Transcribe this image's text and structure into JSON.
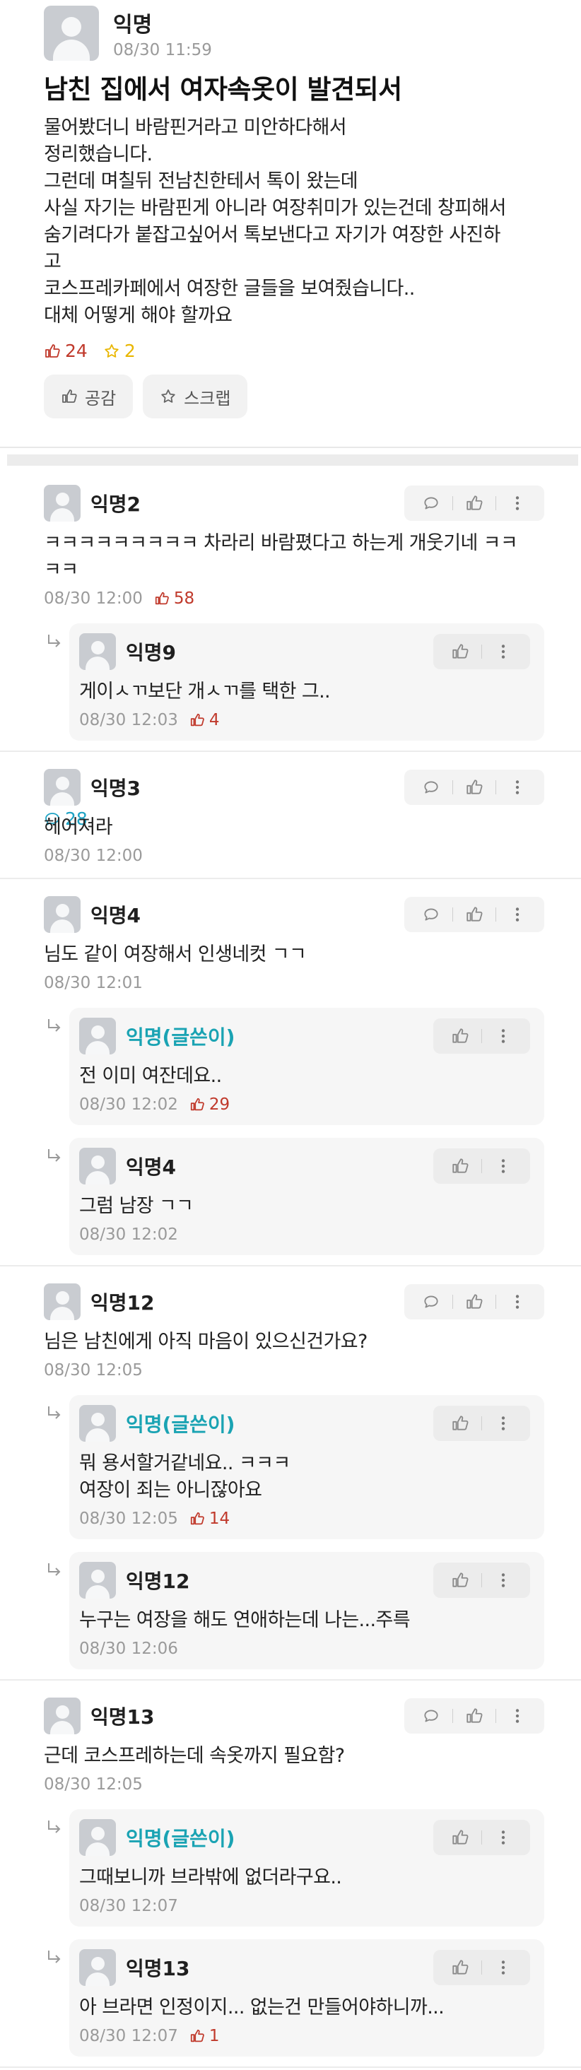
{
  "post": {
    "author": "익명",
    "date": "08/30 11:59",
    "title": "남친 집에서 여자속옷이 발견되서",
    "body": "물어봤더니 바람핀거라고 미안하다해서\n정리했습니다.\n그런데 며칠뒤 전남친한테서 톡이 왔는데\n사실 자기는 바람핀게 아니라 여장취미가 있는건데 창피해서\n숨기려다가 붙잡고싶어서 톡보낸다고 자기가 여장한 사진하\n고\n코스프레카페에서 여장한 글들을 보여줬습니다..\n대체 어떻게 해야 할까요",
    "stats": {
      "likes": "24",
      "comments": "28",
      "scraps": "2"
    },
    "actions": {
      "like_label": "공감",
      "scrap_label": "스크랩"
    },
    "icons": {
      "like": "thumbs-up-icon",
      "comment": "speech-bubble-icon",
      "scrap": "star-icon"
    }
  },
  "comments": [
    {
      "author": "익명2",
      "text": "ㅋㅋㅋㅋㅋㅋㅋㅋㅋ 차라리 바람폈다고 하는게 개웃기네 ㅋㅋ\nㅋㅋ",
      "time": "08/30 12:00",
      "likes": "58",
      "replies": [
        {
          "author": "익명9",
          "op": false,
          "text": "게이ㅅㄲ보단 개ㅅㄲ를 택한 그..",
          "time": "08/30 12:03",
          "likes": "4"
        }
      ]
    },
    {
      "author": "익명3",
      "text": "헤어져라",
      "time": "08/30 12:00",
      "likes": "",
      "replies": []
    },
    {
      "author": "익명4",
      "text": "님도 같이 여장해서 인생네컷 ㄱㄱ",
      "time": "08/30 12:01",
      "likes": "",
      "replies": [
        {
          "author": "익명(글쓴이)",
          "op": true,
          "text": "전 이미 여잔데요..",
          "time": "08/30 12:02",
          "likes": "29"
        },
        {
          "author": "익명4",
          "op": false,
          "text": "그럼 남장 ㄱㄱ",
          "time": "08/30 12:02",
          "likes": ""
        }
      ]
    },
    {
      "author": "익명12",
      "text": "님은 남친에게 아직 마음이 있으신건가요?",
      "time": "08/30 12:05",
      "likes": "",
      "replies": [
        {
          "author": "익명(글쓴이)",
          "op": true,
          "text": "뭐 용서할거같네요.. ㅋㅋㅋ\n여장이 죄는 아니잖아요",
          "time": "08/30 12:05",
          "likes": "14"
        },
        {
          "author": "익명12",
          "op": false,
          "text": "누구는 여장을 해도 연애하는데 나는...주륵",
          "time": "08/30 12:06",
          "likes": ""
        }
      ]
    },
    {
      "author": "익명13",
      "text": "근데 코스프레하는데 속옷까지 필요함?",
      "time": "08/30 12:05",
      "likes": "",
      "replies": [
        {
          "author": "익명(글쓴이)",
          "op": true,
          "text": "그때보니까 브라밖에 없더라구요..",
          "time": "08/30 12:07",
          "likes": ""
        },
        {
          "author": "익명13",
          "op": false,
          "text": "아 브라면 인정이지... 없는건 만들어야하니까...",
          "time": "08/30 12:07",
          "likes": "1"
        }
      ]
    }
  ],
  "colors": {
    "like": "#c0392b",
    "comment": "#1fa3c4",
    "scrap": "#e9b600",
    "op_author": "#1aa3b3",
    "meta": "#9a9a9a"
  }
}
